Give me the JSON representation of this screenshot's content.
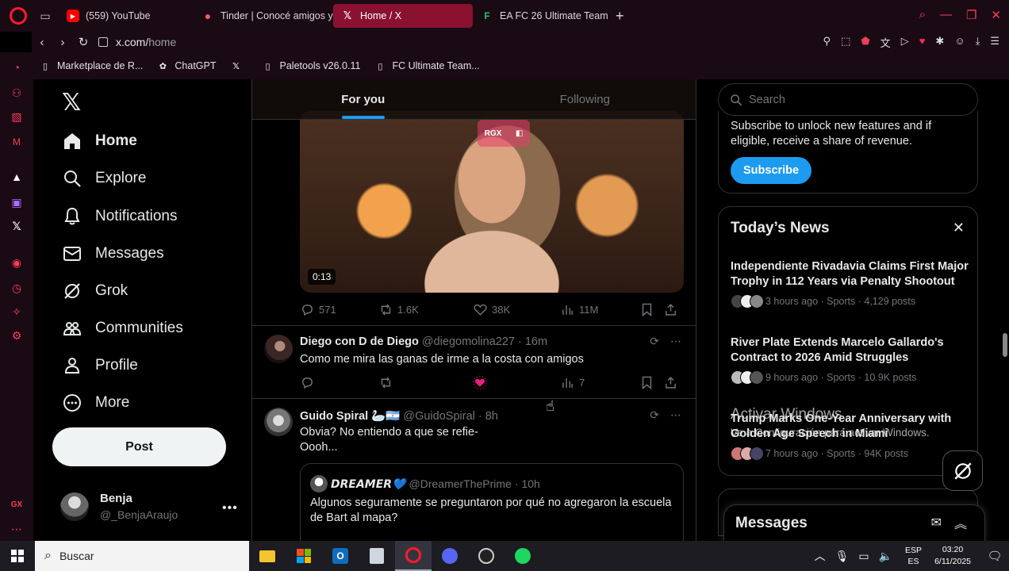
{
  "browser": {
    "tabs": [
      {
        "label": "(559) YouTube",
        "active": false
      },
      {
        "label": "Tinder | Conocé amigos y",
        "active": false
      },
      {
        "label": "Home / X",
        "active": true
      },
      {
        "label": "EA FC 26 Ultimate Team P",
        "active": false
      }
    ],
    "url_host": "x.com/",
    "url_path": "home",
    "bookmarks": [
      "Marketplace de R...",
      "ChatGPT",
      "Paletools v26.0.11",
      "FC Ultimate Team..."
    ]
  },
  "x": {
    "nav": {
      "home": "Home",
      "explore": "Explore",
      "notifications": "Notifications",
      "messages": "Messages",
      "grok": "Grok",
      "communities": "Communities",
      "profile": "Profile",
      "more": "More"
    },
    "post_button": "Post",
    "account": {
      "name": "Benja",
      "handle": "@_BenjaAraujo"
    },
    "timeline_tabs": [
      "For you",
      "Following"
    ],
    "video_tweet": {
      "overlay_badge": "RGX",
      "duration": "0:13",
      "replies": "571",
      "reposts": "1.6K",
      "likes": "38K",
      "views": "11M"
    },
    "tweet1": {
      "name": "Diego con D de Diego",
      "handle": "@diegomolina227",
      "time": "· 16m",
      "text": "Como me mira las ganas de irme a la costa con amigos",
      "views": "7"
    },
    "tweet2": {
      "name": "Guido Spiral",
      "name_emoji": "🦢🇦🇷",
      "handle": "@GuidoSpiral",
      "time": "· 8h",
      "text_line1": "Obvia? No entiendo a que se refie-",
      "text_line2": "Oooh...",
      "quote": {
        "name": "𝘿𝙍𝙀𝘼𝙈𝙀𝙍💙",
        "handle": "@DreamerThePrime",
        "time": "· 10h",
        "text": "Algunos seguramente se preguntaron por qué no agregaron la escuela de Bart al mapa?"
      }
    },
    "search_placeholder": "Search",
    "premium": {
      "text": "Subscribe to unlock new features and if eligible, receive a share of revenue.",
      "button": "Subscribe"
    },
    "news": {
      "title": "Today’s News",
      "items": [
        {
          "headline": "Independiente Rivadavia Claims First Major Trophy in 112 Years via Penalty Shootout",
          "meta": "3 hours ago · Sports · 4,129 posts"
        },
        {
          "headline": "River Plate Extends Marcelo Gallardo's Contract to 2026 Amid Struggles",
          "meta": "9 hours ago · Sports · 10.9K posts"
        },
        {
          "headline": "Trump Marks One-Year Anniversary with Golden Age Speech in Miami",
          "meta": "7 hours ago · Sports · 94K posts"
        }
      ]
    },
    "messages_drawer": "Messages"
  },
  "watermark": {
    "line1": "Activar Windows",
    "line2": "Ve a Configuración para activar Windows."
  },
  "taskbar": {
    "search_placeholder": "Buscar",
    "lang_line1": "ESP",
    "lang_line2": "ES",
    "time": "03:20",
    "date": "6/11/2025"
  },
  "colors": {
    "accent": "#1d9bf0",
    "opera_red": "#ff1b2d",
    "active_tab": "#8a1230",
    "like_pink": "#f91880"
  }
}
